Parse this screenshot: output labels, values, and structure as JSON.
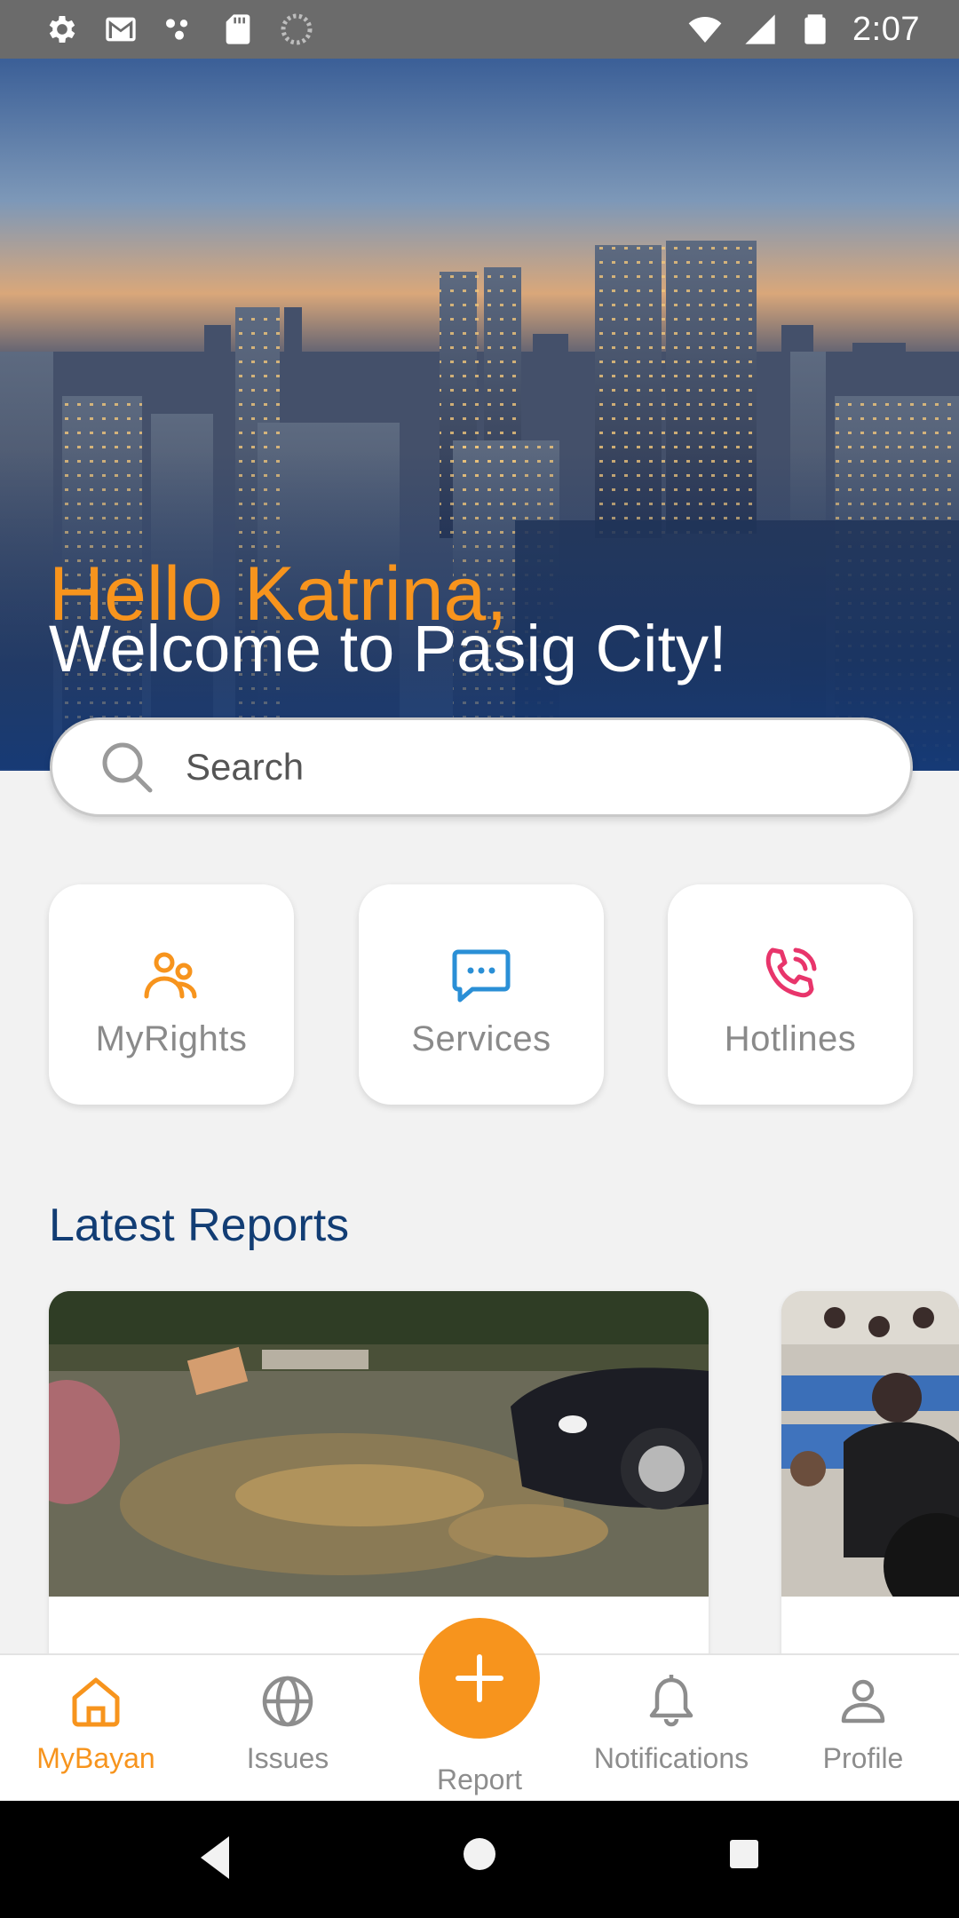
{
  "status_bar": {
    "time": "2:07"
  },
  "hero": {
    "greeting": "Hello Katrina,",
    "welcome": "Welcome to Pasig City!"
  },
  "search": {
    "placeholder": "Search"
  },
  "quick_links": [
    {
      "label": "MyRights",
      "icon": "people-icon",
      "color": "#f7941d"
    },
    {
      "label": "Services",
      "icon": "chat-icon",
      "color": "#2a8fd6"
    },
    {
      "label": "Hotlines",
      "icon": "phone-call-icon",
      "color": "#e8356b"
    }
  ],
  "latest_reports": {
    "title": "Latest Reports"
  },
  "bottom_nav": [
    {
      "label": "MyBayan",
      "icon": "home-icon",
      "active": true
    },
    {
      "label": "Issues",
      "icon": "globe-icon",
      "active": false
    },
    {
      "label": "Report",
      "icon": "plus-icon",
      "active": false
    },
    {
      "label": "Notifications",
      "icon": "bell-icon",
      "active": false
    },
    {
      "label": "Profile",
      "icon": "person-icon",
      "active": false
    }
  ],
  "colors": {
    "accent": "#f7941d",
    "title_blue": "#123d74",
    "services_blue": "#2a8fd6",
    "hotlines_pink": "#e8356b"
  }
}
